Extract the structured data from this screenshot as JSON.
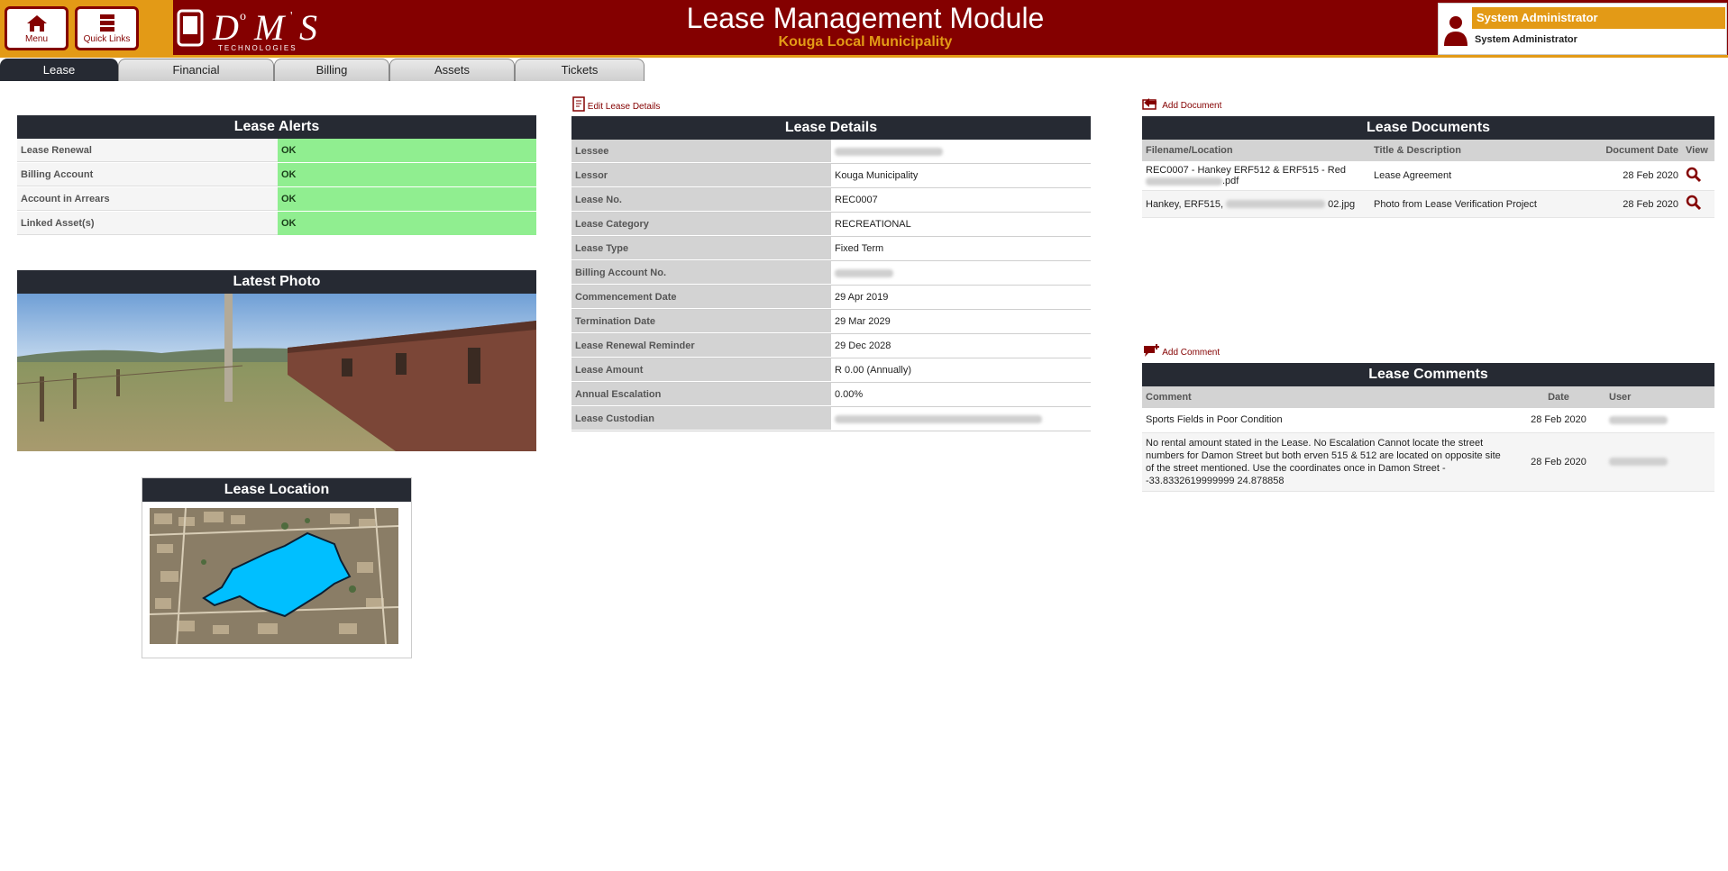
{
  "header": {
    "menu_label": "Menu",
    "quick_links_label": "Quick Links",
    "logo_text": "D M S",
    "logo_sub": "TECHNOLOGIES",
    "title": "Lease Management Module",
    "subtitle": "Kouga Local Municipality",
    "user_role": "System Administrator",
    "user_name": "System Administrator"
  },
  "tabs": [
    {
      "label": "Lease",
      "active": true
    },
    {
      "label": "Financial"
    },
    {
      "label": "Billing"
    },
    {
      "label": "Assets"
    },
    {
      "label": "Tickets"
    }
  ],
  "alerts": {
    "title": "Lease Alerts",
    "rows": [
      {
        "label": "Lease Renewal",
        "value": "OK"
      },
      {
        "label": "Billing Account",
        "value": "OK"
      },
      {
        "label": "Account in Arrears",
        "value": "OK"
      },
      {
        "label": "Linked Asset(s)",
        "value": "OK"
      }
    ]
  },
  "photo": {
    "title": "Latest Photo"
  },
  "location": {
    "title": "Lease Location"
  },
  "details": {
    "edit_label": "Edit Lease Details",
    "title": "Lease Details",
    "rows": [
      {
        "label": "Lessee",
        "value": ""
      },
      {
        "label": "Lessor",
        "value": "Kouga Municipality"
      },
      {
        "label": "Lease No.",
        "value": "REC0007"
      },
      {
        "label": "Lease Category",
        "value": "RECREATIONAL"
      },
      {
        "label": "Lease Type",
        "value": "Fixed Term"
      },
      {
        "label": "Billing Account No.",
        "value": ""
      },
      {
        "label": "Commencement Date",
        "value": "29 Apr 2019"
      },
      {
        "label": "Termination Date",
        "value": "29 Mar 2029"
      },
      {
        "label": "Lease Renewal Reminder",
        "value": "29 Dec 2028"
      },
      {
        "label": "Lease Amount",
        "value": "R 0.00 (Annually)"
      },
      {
        "label": "Annual Escalation",
        "value": "0.00%"
      },
      {
        "label": "Lease Custodian",
        "value": ""
      }
    ]
  },
  "documents": {
    "add_label": "Add Document",
    "title": "Lease Documents",
    "columns": [
      "Filename/Location",
      "Title & Description",
      "Document Date",
      "View"
    ],
    "rows": [
      {
        "file_a": "REC0007 - Hankey ERF512 & ERF515 - Red",
        "file_b": ".pdf",
        "title": "Lease Agreement",
        "date": "28 Feb 2020"
      },
      {
        "file_a": "Hankey, ERF515,",
        "file_b": "02.jpg",
        "title": "Photo from Lease Verification Project",
        "date": "28 Feb 2020"
      }
    ]
  },
  "comments": {
    "add_label": "Add Comment",
    "title": "Lease Comments",
    "columns": [
      "Comment",
      "Date",
      "User"
    ],
    "rows": [
      {
        "comment": "Sports Fields in Poor Condition",
        "date": "28 Feb 2020"
      },
      {
        "comment": "No rental amount stated in the Lease. No Escalation Cannot locate the street numbers for Damon Street but both erven 515 & 512 are located on opposite site of the street mentioned. Use the coordinates once in Damon Street - -33.8332619999999 24.878858",
        "date": "28 Feb 2020"
      }
    ]
  },
  "colors": {
    "brand_red": "#840000",
    "brand_orange": "#e39a16",
    "panel_dark": "#262a33",
    "ok_green": "#90ee90",
    "map_parcel": "#00bfff"
  }
}
